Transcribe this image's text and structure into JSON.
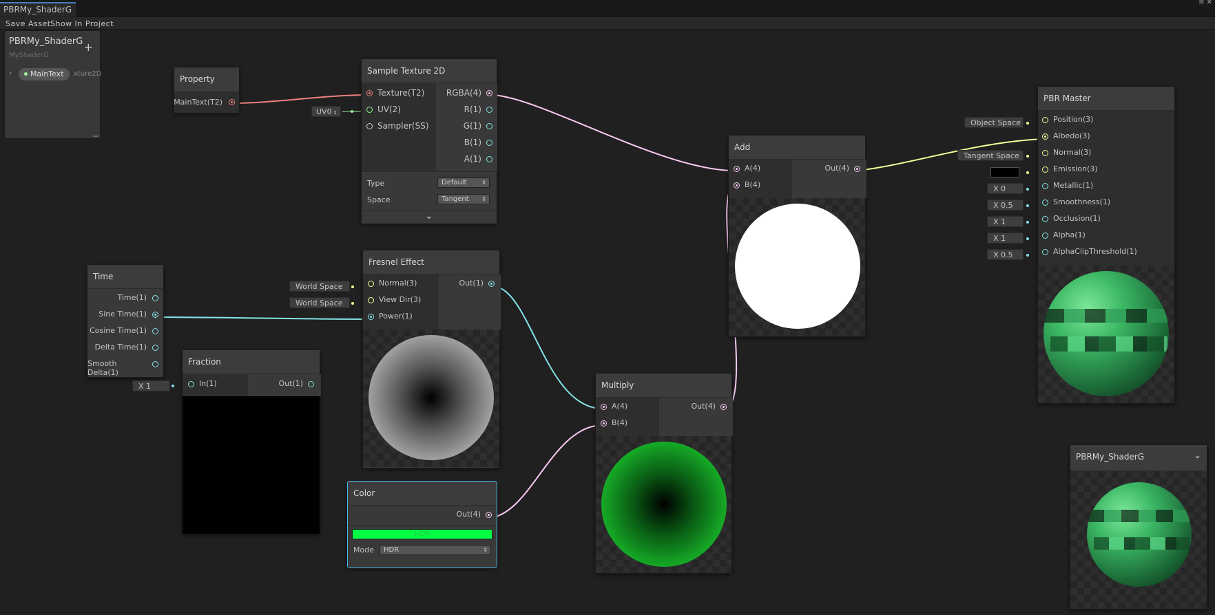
{
  "window": {
    "tab_title": "PBRMy_ShaderG",
    "controls": "≡ ✕"
  },
  "toolbar": {
    "save_asset": "Save Asset",
    "show_in_project": "Show In Project"
  },
  "blackboard": {
    "title": "PBRMy_ShaderG",
    "subtitle": "MyShaderG",
    "add": "+",
    "property_name": "MainText",
    "property_type": "xture2D"
  },
  "nodes": {
    "property": {
      "title": "Property",
      "output": "MainText(T2)"
    },
    "sample_texture": {
      "title": "Sample Texture 2D",
      "inputs": [
        "Texture(T2)",
        "UV(2)",
        "Sampler(SS)"
      ],
      "outputs": [
        "RGBA(4)",
        "R(1)",
        "G(1)",
        "B(1)",
        "A(1)"
      ],
      "uv_field": "UV0",
      "type_label": "Type",
      "type_value": "Default",
      "space_label": "Space",
      "space_value": "Tangent",
      "collapse": "⌄"
    },
    "add": {
      "title": "Add",
      "inputs": [
        "A(4)",
        "B(4)"
      ],
      "output": "Out(4)"
    },
    "pbr_master": {
      "title": "PBR Master",
      "inputs": [
        "Position(3)",
        "Albedo(3)",
        "Normal(3)",
        "Emission(3)",
        "Metallic(1)",
        "Smoothness(1)",
        "Occlusion(1)",
        "Alpha(1)",
        "AlphaClipThreshold(1)"
      ],
      "fields": [
        "Object Space",
        "",
        "Tangent Space",
        "",
        "X  0",
        "X  0.5",
        "X  1",
        "X  1",
        "X  0.5"
      ]
    },
    "time": {
      "title": "Time",
      "outputs": [
        "Time(1)",
        "Sine Time(1)",
        "Cosine Time(1)",
        "Delta Time(1)",
        "Smooth Delta(1)"
      ]
    },
    "fresnel": {
      "title": "Fresnel Effect",
      "inputs": [
        "Normal(3)",
        "View Dir(3)",
        "Power(1)"
      ],
      "output": "Out(1)",
      "fields": [
        "World Space",
        "World Space"
      ]
    },
    "fraction": {
      "title": "Fraction",
      "input": "In(1)",
      "output": "Out(1)",
      "field": "X  1"
    },
    "multiply": {
      "title": "Multiply",
      "inputs": [
        "A(4)",
        "B(4)"
      ],
      "output": "Out(4)"
    },
    "color": {
      "title": "Color",
      "output": "Out(4)",
      "hdr_label": "HDR",
      "swatch_color": "#00ff44",
      "mode_label": "Mode",
      "mode_value": "HDR"
    }
  },
  "main_preview": {
    "title": "PBRMy_ShaderG",
    "menu": "⌄"
  },
  "colors": {
    "texture_port": "#f08080",
    "vector3_port": "#f6ff9a",
    "vector1_port": "#84e4e7",
    "vector4_port": "#fbcbf4",
    "vector2_port": "#9aef92",
    "selection": "#44c0f0"
  }
}
